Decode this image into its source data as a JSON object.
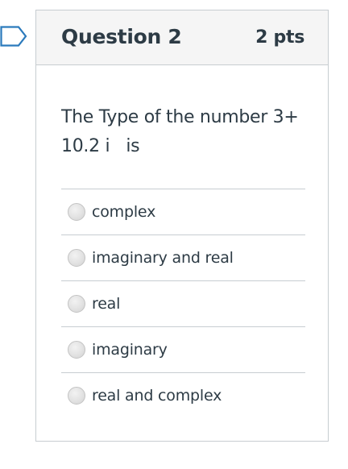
{
  "question": {
    "title": "Question 2",
    "points": "2 pts",
    "text": "The Type of the number 3+ 10.2 i   is"
  },
  "answers": [
    {
      "label": "complex",
      "selected": false
    },
    {
      "label": "imaginary and real",
      "selected": false
    },
    {
      "label": "real",
      "selected": false
    },
    {
      "label": "imaginary",
      "selected": false
    },
    {
      "label": "real and complex",
      "selected": false
    }
  ],
  "colors": {
    "text": "#2d3b45",
    "border": "#c7cdd1",
    "header_bg": "#f5f5f5",
    "flag": "#2b7abc"
  },
  "icons": {
    "flag": "flag-question-icon"
  }
}
